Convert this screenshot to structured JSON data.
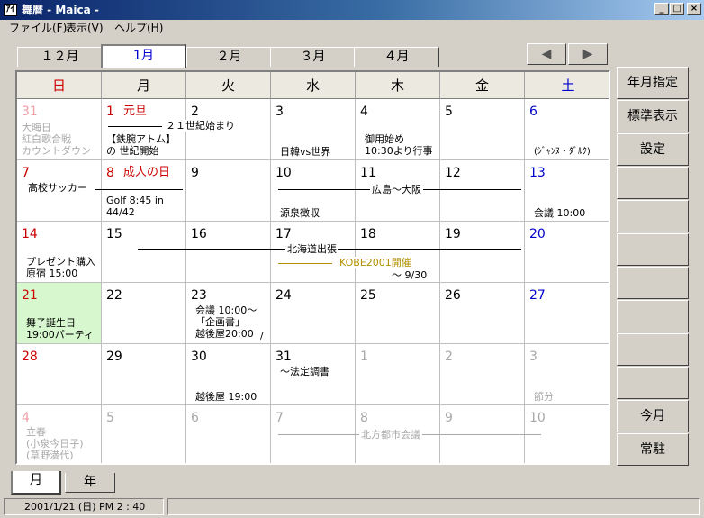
{
  "window": {
    "title": "舞暦 - Maica -",
    "app_icon_text": "ｱｲ",
    "minimize": "_",
    "maximize": "□",
    "close": "×"
  },
  "menu": [
    "ファイル(F)",
    "表示(V)",
    "ヘルプ(H)"
  ],
  "month_tabs": [
    "１２月",
    "1月",
    "２月",
    "３月",
    "４月"
  ],
  "nav": {
    "prev": "◀",
    "next": "▶"
  },
  "weekdays": [
    "日",
    "月",
    "火",
    "水",
    "木",
    "金",
    "土"
  ],
  "colors": {
    "sunday": "#cc0000",
    "saturday": "#0000cc",
    "other_month": "#a8a8a8",
    "today_bg": "#d7f8cf"
  },
  "weeks": [
    [
      {
        "day": "31",
        "lines": [
          "大晦日",
          "紅白歌合戦",
          "カウントダウン"
        ]
      },
      {
        "day": "1",
        "title": "元旦",
        "lines": [
          "【鉄腕アトム】",
          "の 世紀開始"
        ]
      },
      {
        "day": "2",
        "lines": []
      },
      {
        "day": "3",
        "lines": [
          "日韓vs世界"
        ]
      },
      {
        "day": "4",
        "lines": [
          "御用始め",
          "10:30より行事"
        ]
      },
      {
        "day": "5",
        "lines": []
      },
      {
        "day": "6",
        "lines": [
          "(ｼﾞｬﾝﾇ・ﾀﾞﾙｸ)"
        ]
      }
    ],
    [
      {
        "day": "7",
        "lines": [
          "高校サッカー"
        ]
      },
      {
        "day": "8",
        "title": "成人の日",
        "lines": [
          "Golf 8:45 in",
          "44/42"
        ]
      },
      {
        "day": "9",
        "lines": []
      },
      {
        "day": "10",
        "lines": [
          "源泉徴収"
        ]
      },
      {
        "day": "11",
        "lines": []
      },
      {
        "day": "12",
        "lines": []
      },
      {
        "day": "13",
        "lines": [
          "会議 10:00"
        ]
      }
    ],
    [
      {
        "day": "14",
        "lines": [
          "プレゼント購入",
          "原宿 15:00"
        ]
      },
      {
        "day": "15",
        "lines": []
      },
      {
        "day": "16",
        "lines": []
      },
      {
        "day": "17",
        "lines": []
      },
      {
        "day": "18",
        "lines": []
      },
      {
        "day": "19",
        "lines": []
      },
      {
        "day": "20",
        "lines": []
      }
    ],
    [
      {
        "day": "21",
        "lines": [
          "舞子誕生日",
          "19:00パーティ"
        ]
      },
      {
        "day": "22",
        "lines": []
      },
      {
        "day": "23",
        "lines": [
          "会議 10:00～",
          "「企画書」",
          "越後屋20:00"
        ]
      },
      {
        "day": "24",
        "lines": []
      },
      {
        "day": "25",
        "lines": []
      },
      {
        "day": "26",
        "lines": []
      },
      {
        "day": "27",
        "lines": []
      }
    ],
    [
      {
        "day": "28",
        "lines": []
      },
      {
        "day": "29",
        "lines": []
      },
      {
        "day": "30",
        "lines": [
          "越後屋 19:00"
        ]
      },
      {
        "day": "31",
        "lines": [
          "～法定調書"
        ]
      },
      {
        "day": "1",
        "lines": []
      },
      {
        "day": "2",
        "lines": []
      },
      {
        "day": "3",
        "lines": [
          "節分"
        ]
      }
    ],
    [
      {
        "day": "4",
        "lines": [
          "立春",
          "(小泉今日子)",
          "(草野満代)"
        ]
      },
      {
        "day": "5",
        "lines": []
      },
      {
        "day": "6",
        "lines": []
      },
      {
        "day": "7",
        "lines": []
      },
      {
        "day": "8",
        "lines": []
      },
      {
        "day": "9",
        "lines": []
      },
      {
        "day": "10",
        "lines": []
      }
    ]
  ],
  "spans": {
    "century": "２１世紀始まり",
    "hiroshima": "広島～大阪",
    "hokkaido": "北海道出張",
    "kobe": "KOBE2001開催",
    "kobe_end": "～ 9/30",
    "hoppo": "北方都市会議",
    "slash": "/"
  },
  "side_buttons": [
    "年月指定",
    "標準表示",
    "設定",
    "",
    "",
    "",
    "",
    "",
    "",
    "",
    "今月",
    "常駐"
  ],
  "bottom_tabs": [
    "月",
    "年"
  ],
  "status": {
    "datetime": "2001/1/21 (日) PM 2 : 40",
    "extra": ""
  }
}
